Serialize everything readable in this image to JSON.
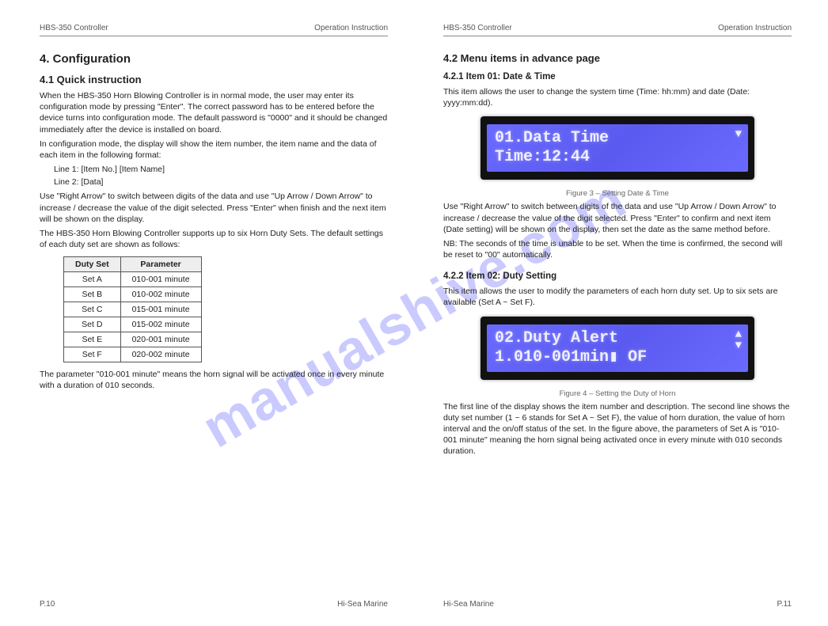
{
  "watermark": "manualshive.com",
  "left": {
    "header_left": "HBS-350 Controller",
    "header_right": "Operation Instruction",
    "h1": "4.  Configuration",
    "h2": "4.1  Quick instruction",
    "p1": "When the HBS-350 Horn Blowing Controller is in normal mode, the user may enter its configuration mode by pressing \"Enter\". The correct password has to be entered before the device turns into configuration mode. The default password is \"0000\" and it should be changed immediately after the device is installed on board.",
    "p2": "In configuration mode, the display will show the item number, the item name and the data of each item in the following format:",
    "line1": "Line 1: [Item No.] [Item Name]",
    "line2": "Line 2: [Data]",
    "p3": "Use \"Right Arrow\" to switch between digits of the data and use \"Up Arrow / Down Arrow\" to increase / decrease the value of the digit selected. Press \"Enter\" when finish and the next item will be shown on the display.",
    "duty_sets": "The HBS-350 Horn Blowing Controller supports up to six Horn Duty Sets. The default settings of each duty set are shown as follows:",
    "table": {
      "head": [
        "Duty Set",
        "Parameter"
      ],
      "rows": [
        [
          "Set A",
          "010-001 minute"
        ],
        [
          "Set B",
          "010-002 minute"
        ],
        [
          "Set C",
          "015-001 minute"
        ],
        [
          "Set D",
          "015-002 minute"
        ],
        [
          "Set E",
          "020-001 minute"
        ],
        [
          "Set F",
          "020-002 minute"
        ]
      ]
    },
    "p4": "The parameter \"010-001 minute\" means the horn signal will be activated once in every minute with a duration of 010 seconds.",
    "footer_left": "P.10",
    "footer_right": "Hi-Sea Marine"
  },
  "right": {
    "header_left": "HBS-350 Controller",
    "header_right": "Operation Instruction",
    "h2": "4.2  Menu items in advance page",
    "sub1": "4.2.1  Item 01: Date & Time",
    "p1a": "This item allows the user to change the system time (Time: hh:mm) and date (Date: yyyy:mm:dd).",
    "lcd1_line1": "01.Data Time",
    "lcd1_line2": "Time:12:44",
    "fig1": "Figure 3 – Setting Date & Time",
    "p1b": "Use \"Right Arrow\" to switch between digits of the data and use \"Up Arrow / Down Arrow\" to increase / decrease the value of the digit selected. Press \"Enter\" to confirm and next item (Date setting) will be shown on the display, then set the date as the same method before.",
    "p1c": "NB: The seconds of the time is unable to be set. When the time is confirmed, the second will be reset to \"00\" automatically.",
    "sub2": "4.2.2  Item 02: Duty Setting",
    "p2a": "This item allows the user to modify the parameters of each horn duty set. Up to six sets are available (Set A ~ Set F).",
    "lcd2_line1": "02.Duty Alert",
    "lcd2_line2": "1.010-001min▮ OF",
    "fig2": "Figure 4 – Setting the Duty of Horn",
    "p2b": "The first line of the display shows the item number and description. The second line shows the duty set number (1 ~ 6 stands for Set A ~ Set F), the value of horn duration, the value of horn interval and the on/off status of the set. In the figure above, the parameters of Set A is \"010-001 minute\" meaning the horn signal being activated once in every minute with 010 seconds duration.",
    "footer_left": "Hi-Sea Marine",
    "footer_right": "P.11"
  }
}
